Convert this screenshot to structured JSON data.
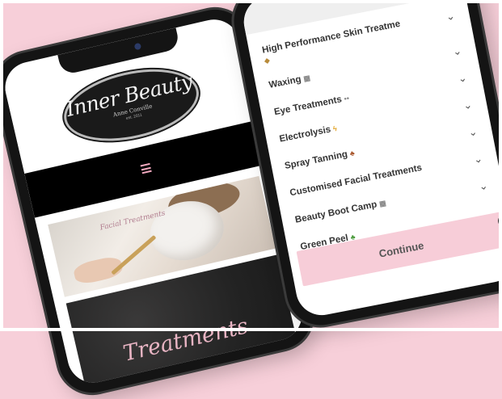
{
  "left_phone": {
    "logo": {
      "title": "Inner Beauty",
      "subtitle": "Anne Conville",
      "est": "est. 2011"
    },
    "photo_caption": "Facial Treatments",
    "section_title": "Treatments"
  },
  "right_phone": {
    "services": [
      {
        "label": "High Performance Skin Treatme",
        "icon": "gem"
      },
      {
        "label": "Waxing",
        "icon": "calendar"
      },
      {
        "label": "Eye Treatments",
        "icon": "eyes"
      },
      {
        "label": "Electrolysis",
        "icon": "lightning"
      },
      {
        "label": "Spray Tanning",
        "icon": "leaf"
      },
      {
        "label": "Customised Facial Treatments",
        "icon": ""
      },
      {
        "label": "Beauty Boot Camp",
        "icon": "calendar"
      },
      {
        "label": "Green Peel",
        "icon": "leaf"
      }
    ],
    "continue_label": "Continue"
  },
  "colors": {
    "background": "#f7cfd9",
    "accent_pink": "#f2a9bf",
    "button_pink": "#f7cdd8",
    "dark": "#141414"
  }
}
